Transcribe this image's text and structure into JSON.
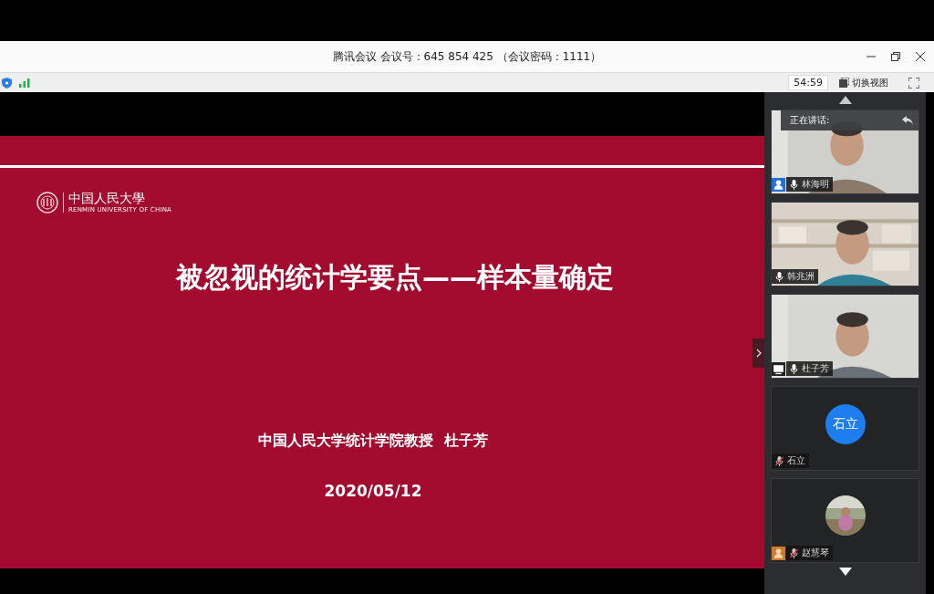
{
  "window": {
    "title": "腾讯会议 会议号：645 854 425 （会议密码：1111）"
  },
  "toolbar": {
    "timer": "54:59",
    "view_button": "切换视图"
  },
  "slide": {
    "logo_name": "中国人民大學",
    "logo_subtitle": "RENMIN UNIVERSITY OF CHINA",
    "title": "被忽视的统计学要点——样本量确定",
    "author": "中国人民大学统计学院教授  杜子芳",
    "date": "2020/05/12"
  },
  "speaking": {
    "label": "正在讲话:"
  },
  "participants": [
    {
      "name": "林海明",
      "kind": "video",
      "badge": {
        "kind": "host"
      },
      "muted": false
    },
    {
      "name": "韩兆洲",
      "kind": "video",
      "muted": false
    },
    {
      "name": "杜子芳",
      "kind": "video",
      "badge": {
        "kind": "sharing"
      },
      "muted": false
    },
    {
      "name": "石立",
      "kind": "initials",
      "initials": "石立",
      "muted": true
    },
    {
      "name": "赵慧琴",
      "badge": {
        "kind": "guest"
      },
      "muted": true
    }
  ]
}
